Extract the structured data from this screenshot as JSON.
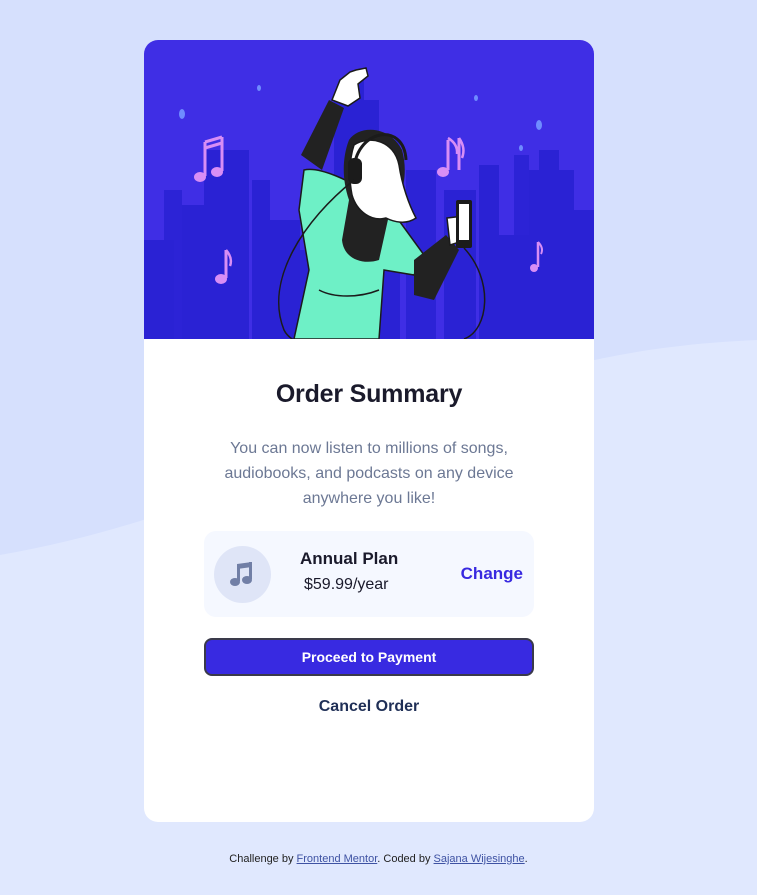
{
  "page": {
    "background_color": "#e0e8fe",
    "wave_color": "#d6e0fd"
  },
  "card": {
    "hero_alt": "illustration-hero",
    "title": "Order Summary",
    "description": "You can now listen to millions of songs, audiobooks, and podcasts on any device anywhere you like!"
  },
  "plan": {
    "icon": "music-note-icon",
    "name": "Annual Plan",
    "price": "$59.99/year",
    "change_label": "Change"
  },
  "actions": {
    "pay_label": "Proceed to Payment",
    "cancel_label": "Cancel Order"
  },
  "footer": {
    "prefix": "Challenge by ",
    "link1": "Frontend Mentor",
    "middle": ". Coded by ",
    "link2": "Sajana Wijesinghe",
    "suffix": "."
  },
  "colors": {
    "accent": "#382ae1",
    "hero_bg": "#3f2ee5",
    "text_dark": "#1a1a2b",
    "text_muted": "#6c7894"
  }
}
